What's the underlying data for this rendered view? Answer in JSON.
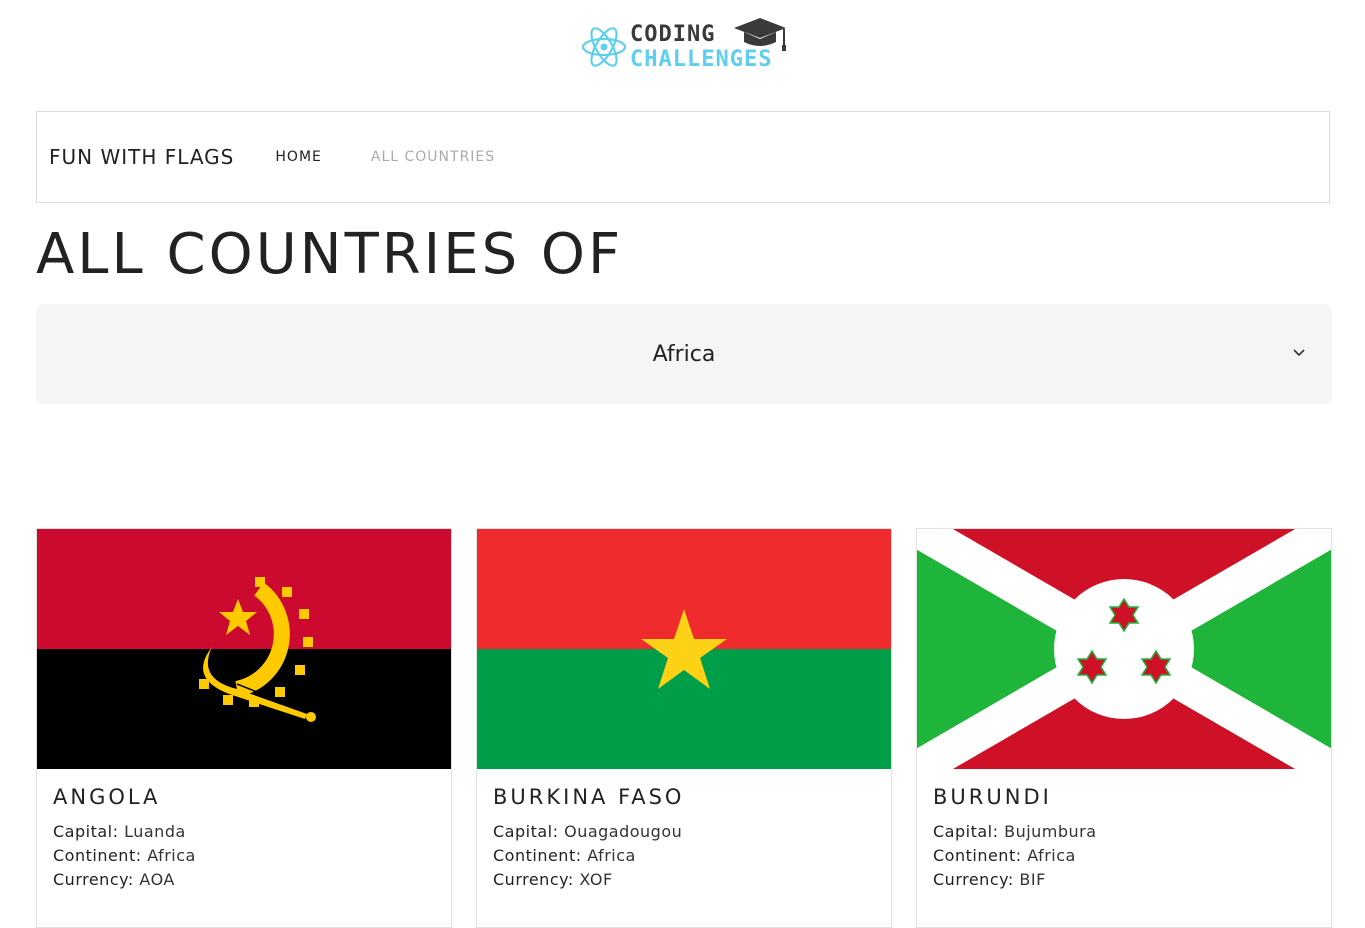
{
  "logo": {
    "line1": "CODING",
    "line2": "CHALLENGES"
  },
  "navbar": {
    "brand": "FUN WITH FLAGS",
    "links": [
      "HOME",
      "ALL COUNTRIES"
    ]
  },
  "page_title": "ALL COUNTRIES OF",
  "continent_select": {
    "value": "Africa"
  },
  "labels": {
    "capital": "Capital:",
    "continent": "Continent:",
    "currency": "Currency:"
  },
  "countries": [
    {
      "name": "ANGOLA",
      "capital": "Luanda",
      "continent": "Africa",
      "currency": "AOA"
    },
    {
      "name": "BURKINA FASO",
      "capital": "Ouagadougou",
      "continent": "Africa",
      "currency": "XOF"
    },
    {
      "name": "BURUNDI",
      "capital": "Bujumbura",
      "continent": "Africa",
      "currency": "BIF"
    }
  ],
  "colors": {
    "logo_blue": "#5fcff0",
    "logo_dark": "#3a3a3a",
    "nav_active": "#aaaaaa",
    "select_bg": "#f5f5f7"
  }
}
